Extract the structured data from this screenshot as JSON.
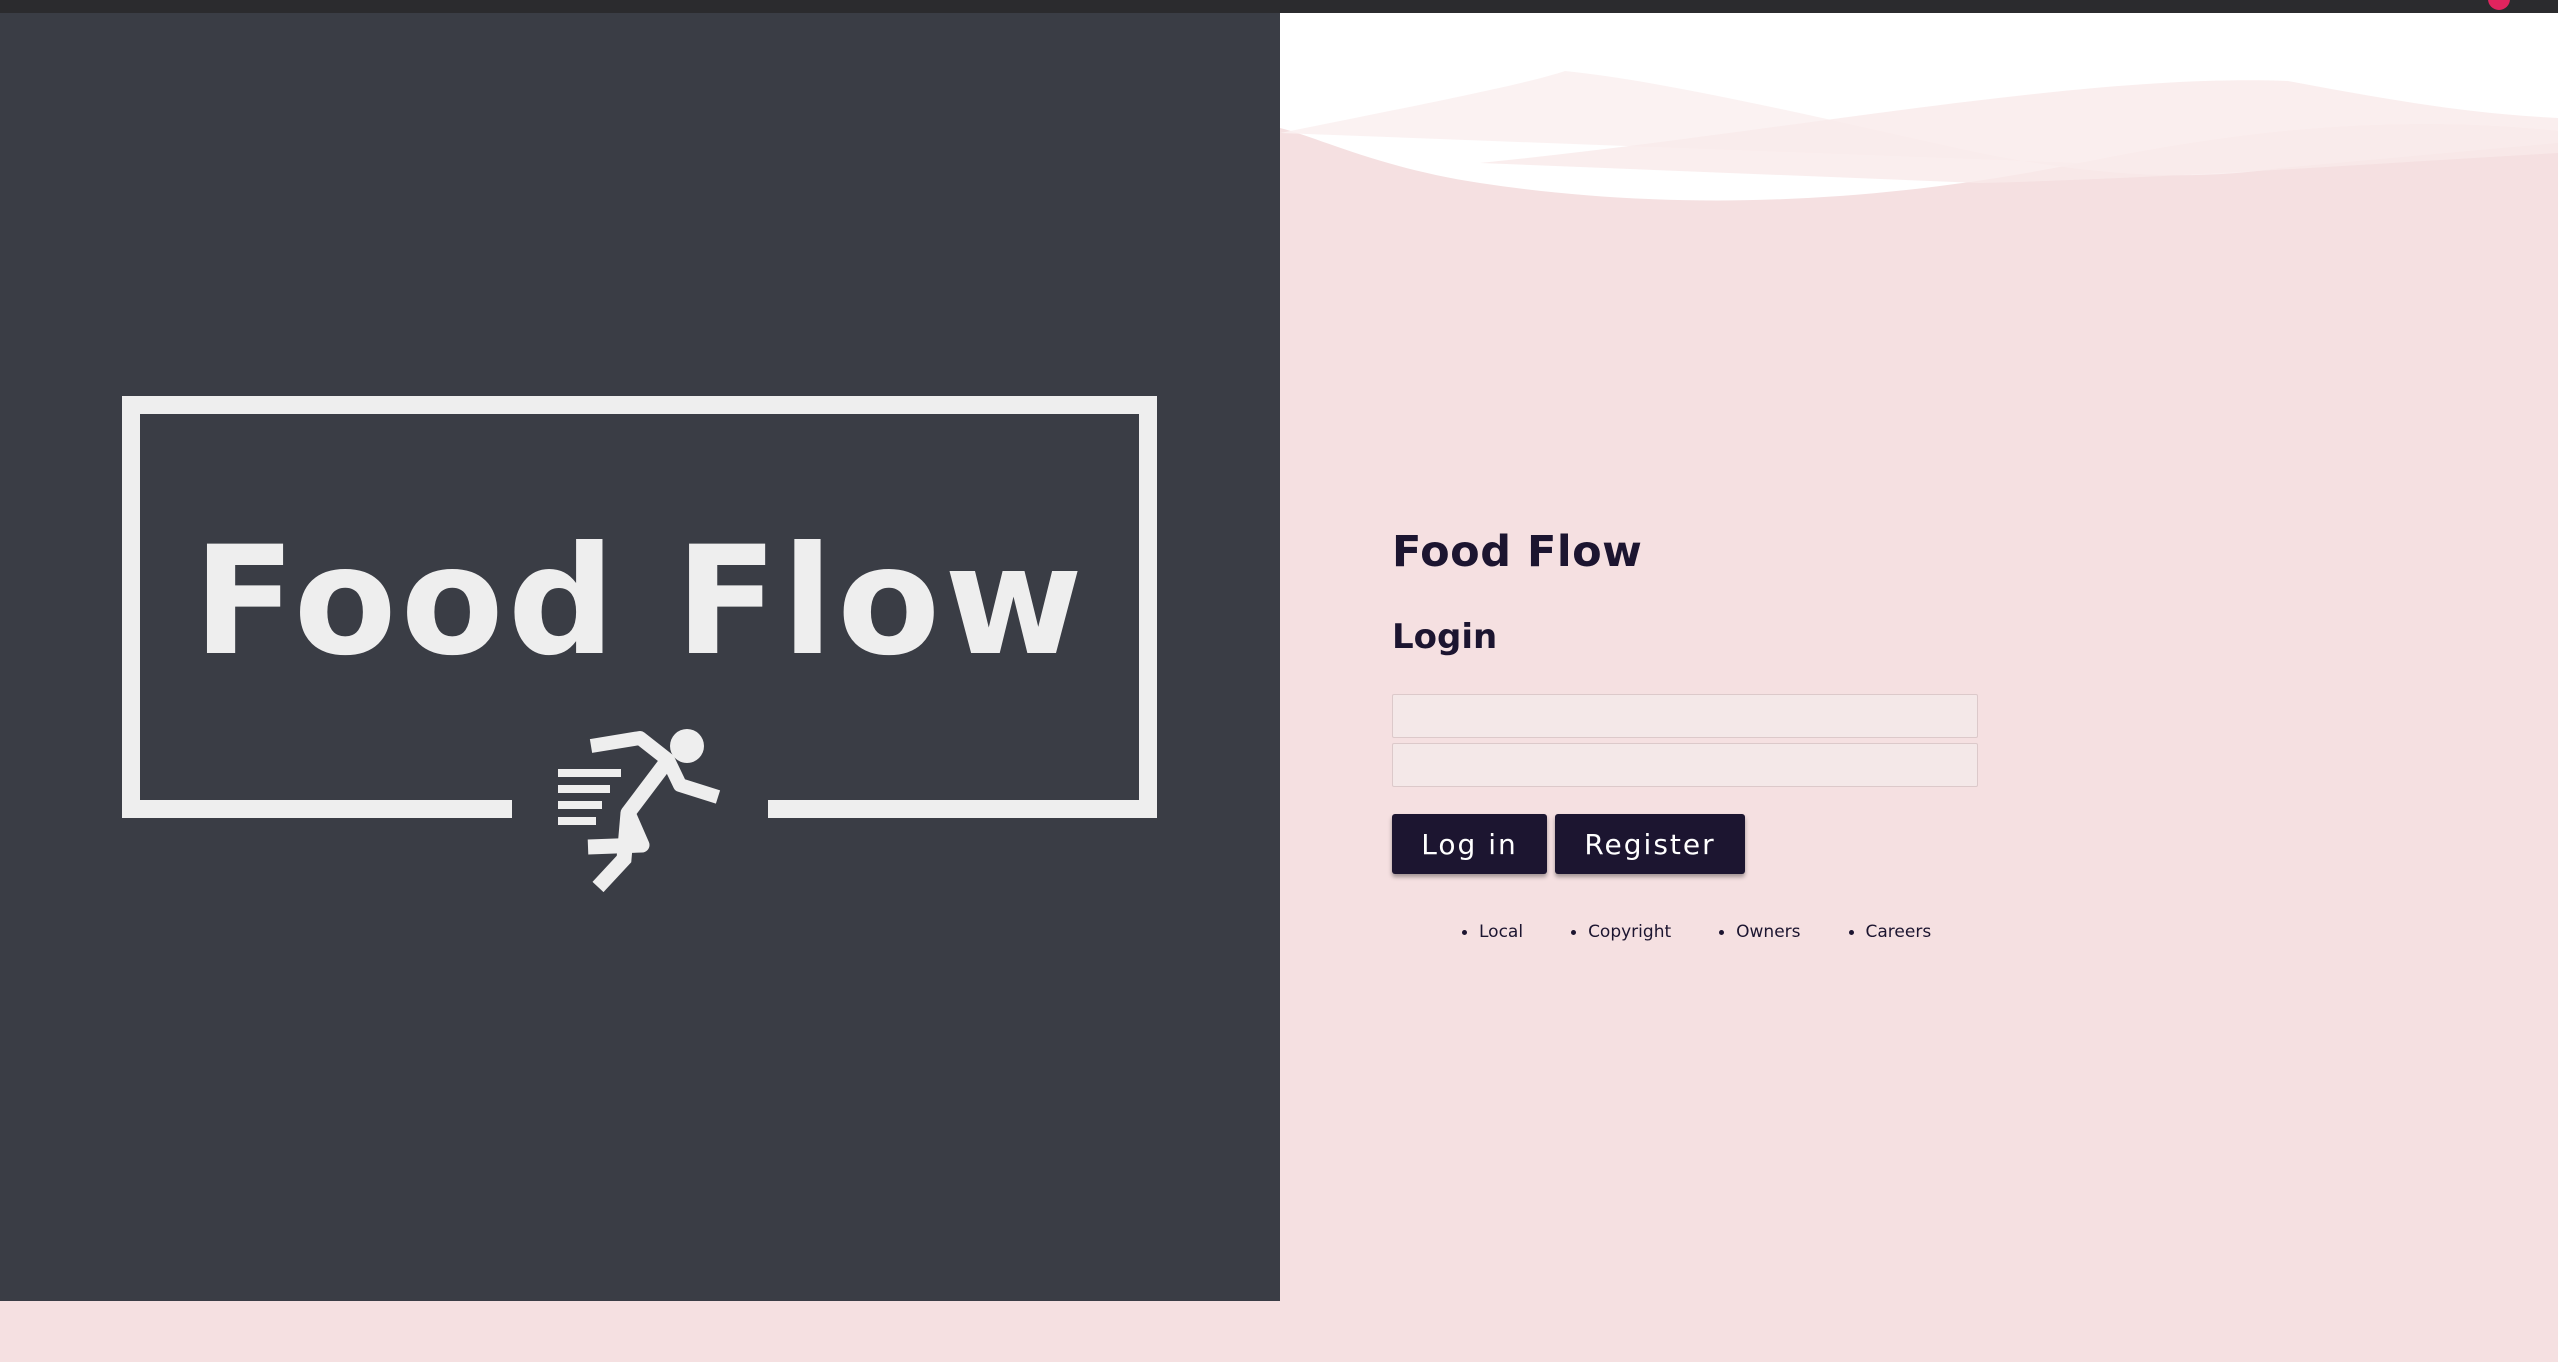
{
  "colors": {
    "left_panel": "#3a3d45",
    "right_panel": "#f5e0e1",
    "primary_dark": "#1c1530",
    "logo_white": "#eeeeee"
  },
  "logo": {
    "text": "Food Flow",
    "icon": "running-person-icon"
  },
  "login": {
    "app_title": "Food Flow",
    "heading": "Login",
    "username_value": "",
    "password_value": "",
    "login_label": "Log in",
    "register_label": "Register"
  },
  "footer": {
    "links": [
      "Local",
      "Copyright",
      "Owners",
      "Careers"
    ]
  }
}
